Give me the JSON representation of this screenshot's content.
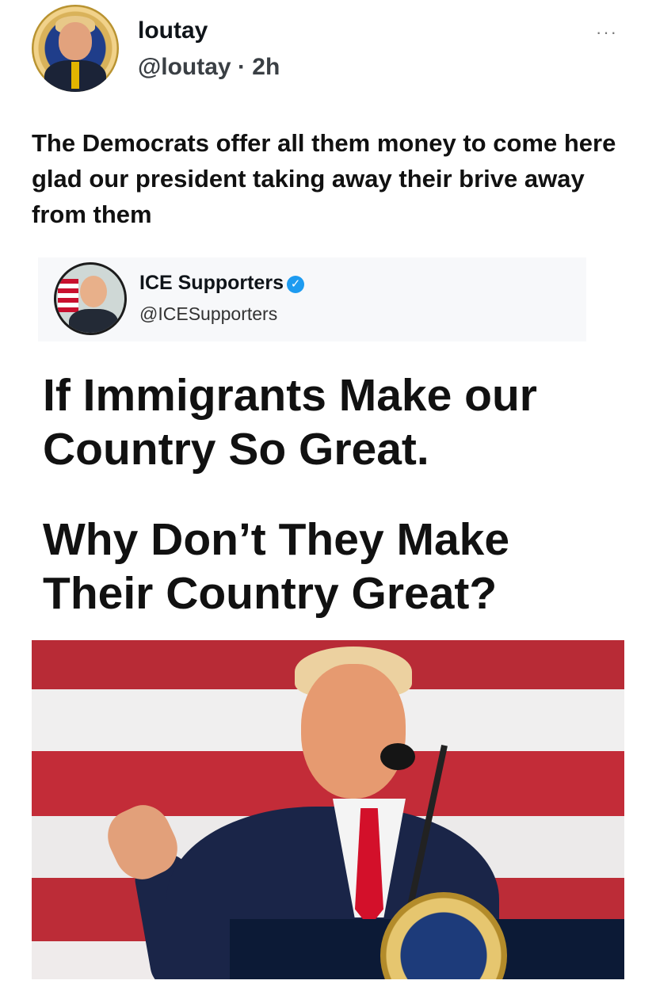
{
  "post": {
    "author_name": "loutay",
    "author_handle": "@loutay",
    "separator": "·",
    "time_ago": "2h",
    "more_label": "···",
    "text": "The Democrats offer all them  money to come here glad our president taking away their brive away from them"
  },
  "embed": {
    "name": "ICE Supporters",
    "verified_glyph": "✓",
    "handle": "@ICESupporters",
    "headline_1": "If Immigrants Make our Country So Great.",
    "headline_2": "Why Don’t They Make Their Country Great?"
  },
  "icons": {
    "more": "more-horizontal-icon",
    "verified": "verified-badge-icon"
  },
  "colors": {
    "verified": "#1d9bf0",
    "text": "#0f1419"
  }
}
